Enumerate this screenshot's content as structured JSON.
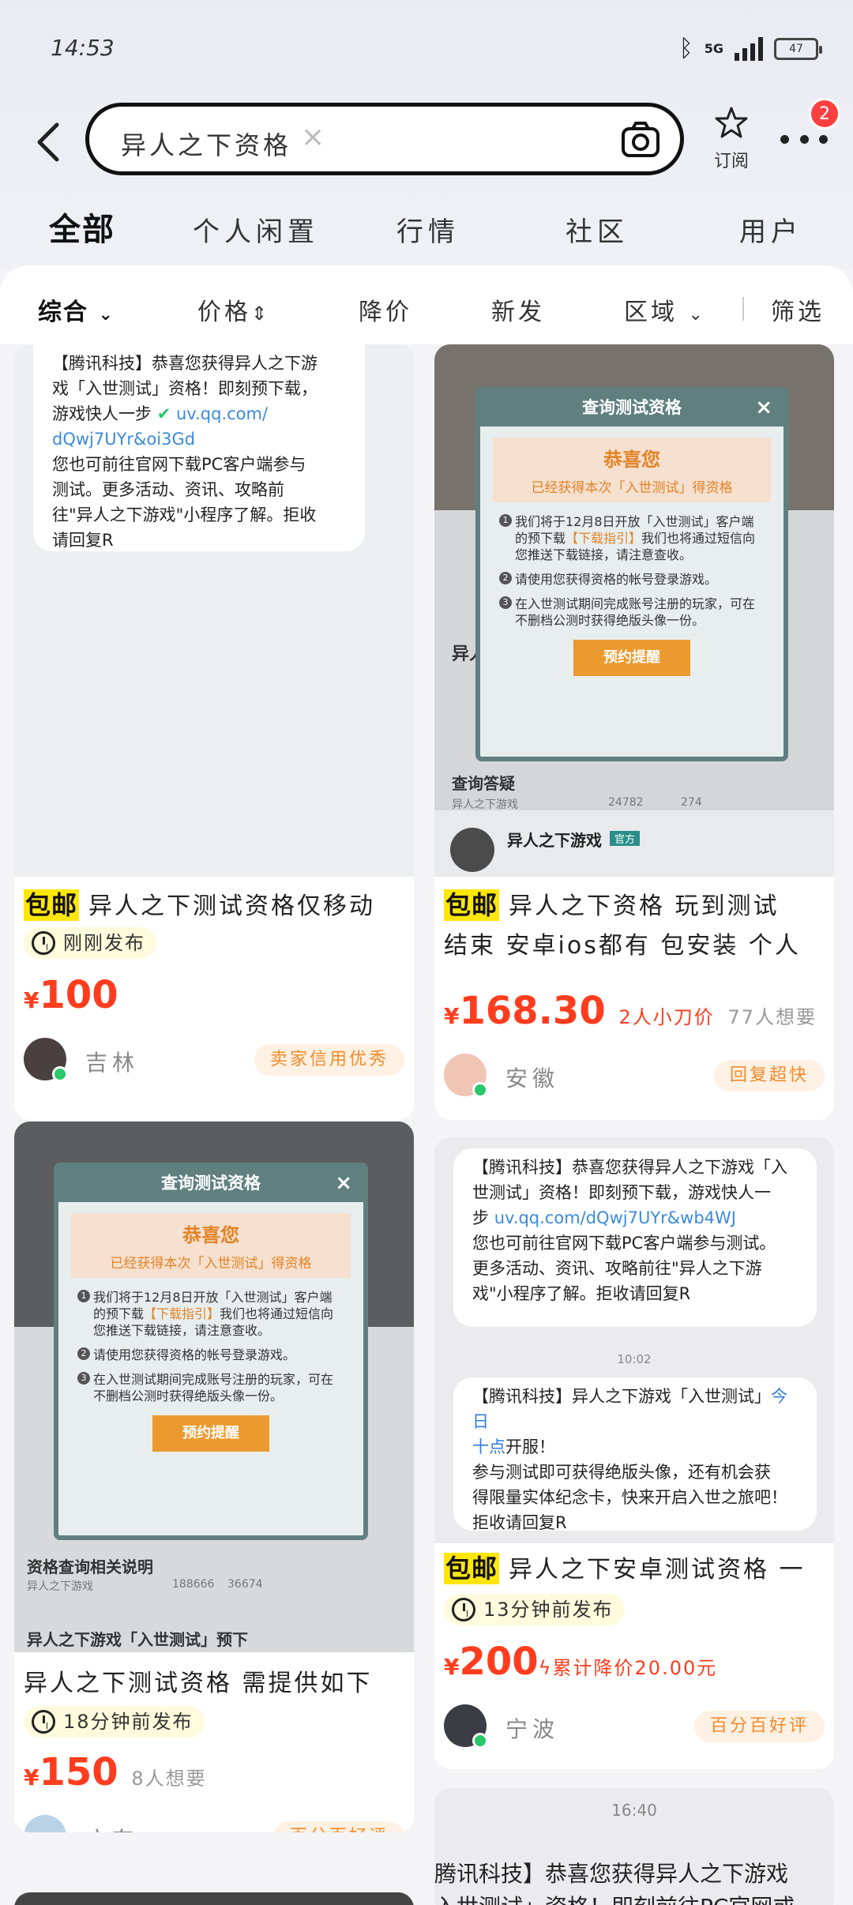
{
  "status": {
    "time": "14:53",
    "network": "5G",
    "battery": "47"
  },
  "search": {
    "query": "异人之下资格",
    "clear": "×"
  },
  "header": {
    "subscribe_label": "订阅",
    "badge_count": "2"
  },
  "tabs": [
    "全部",
    "个人闲置",
    "行情",
    "社区",
    "用户"
  ],
  "filters": {
    "comprehensive": "综合",
    "price": "价格",
    "price_drop": "降价",
    "new": "新发",
    "region": "区域",
    "filter": "筛选"
  },
  "colors": {
    "price": "#ff3d1e",
    "highlight": "#ffe60a",
    "rating": "#f28b2c",
    "online": "#2bc76b"
  },
  "cards": [
    {
      "screenshot_lines": [
        "【腾讯科技】恭喜您获得异人之下游",
        "戏「入世测试」资格！即刻预下载，",
        "游戏快人一步",
        "uv.qq.com/",
        "dQwj7UYr&oi3Gd",
        "您也可前往官网下载PC客户端参与",
        "测试。更多活动、资讯、攻略前",
        "往\"异人之下游戏\"小程序了解。拒收",
        "请回复R"
      ],
      "title_tag": "包邮",
      "title": "异人之下测试资格仅移动",
      "published": "刚刚发布",
      "price": "100",
      "location": "吉林",
      "rating": "卖家信用优秀"
    },
    {
      "dialog": {
        "title": "查询测试资格",
        "congrats": "恭喜您",
        "sub": "已经获得本次「入世测试」得资格",
        "items": [
          "我们将于12月8日开放「入世测试」客户端的预下载",
          "【下载指引】",
          "我们也将通过短信向您推送下载链接，请注意查收。",
          "请使用您获得资格的帐号登录游戏。",
          "在入世测试期间完成账号注册的玩家，可在不删档公测时获得绝版头像一份。"
        ],
        "button": "预约提醒"
      },
      "bg_texts": [
        "异人",
        "查询答疑",
        "异人之下游戏",
        "24782",
        "274",
        "异人之下游戏",
        "官方"
      ],
      "title_tag": "包邮",
      "title_line1": "异人之下资格 玩到测试",
      "title_line2": "结束 安卓ios都有 包安装 个人",
      "price": "168.30",
      "price_note": "2人小刀价",
      "want": "77人想要",
      "location": "安徽",
      "rating": "回复超快"
    },
    {
      "dialog": {
        "title": "查询测试资格",
        "congrats": "恭喜您",
        "sub": "已经获得本次「入世测试」得资格",
        "items": [
          "我们将于12月8日开放「入世测试」客户端的预下载",
          "【下载指引】",
          "我们也将通过短信向您推送下载链接，请注意查收。",
          "请使用您获得资格的帐号登录游戏。",
          "在入世测试期间完成账号注册的玩家，可在不删档公测时获得绝版头像一份。"
        ],
        "button": "预约提醒"
      },
      "bg_texts": [
        "资格查询相关说明",
        "异人之下游戏",
        "188666",
        "36674",
        "异人之下游戏「入世测试」预下"
      ],
      "title": "异人之下测试资格 需提供如下",
      "published": "18分钟前发布",
      "price": "150",
      "want": "8人想要",
      "location": "广东",
      "rating": "百分百好评"
    },
    {
      "msg1": [
        "【腾讯科技】恭喜您获得异人之下游戏「入",
        "世测试」资格！即刻预下载，游戏快人一",
        "步",
        "uv.qq.com/dQwj7UYr&wb4WJ",
        "您也可前往官网下载PC客户端参与测试。",
        "更多活动、资讯、攻略前往\"异人之下游",
        "戏\"小程序了解。拒收请回复R"
      ],
      "msg_time": "10:02",
      "msg2": [
        "【腾讯科技】异人之下游戏「入世测试」",
        "今日",
        "十点",
        "开服！",
        "参与测试即可获得绝版头像，还有机会获",
        "得限量实体纪念卡，快来开启入世之旅吧！",
        "拒收请回复R"
      ],
      "title_tag": "包邮",
      "title": "异人之下安卓测试资格 一",
      "published": "13分钟前发布",
      "price": "200",
      "price_note": "累计降价20.00元",
      "location": "宁波",
      "rating": "百分百好评"
    },
    {
      "msg_time": "16:40",
      "lines": [
        "腾讯科技】恭喜您获得异人之下游戏",
        "入世测试」资格！即刻前往PC官网或"
      ]
    }
  ]
}
